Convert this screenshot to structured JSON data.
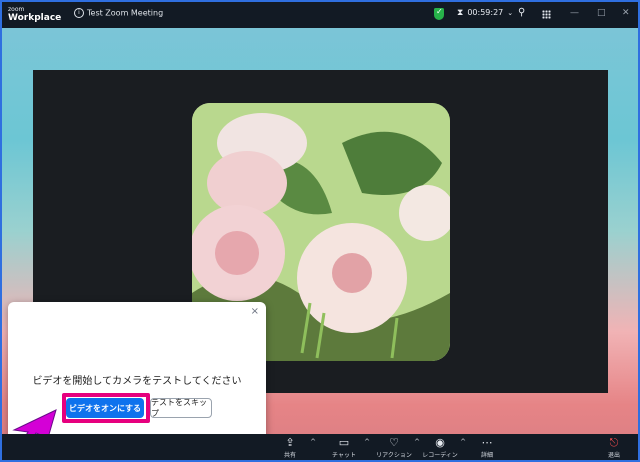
{
  "app": {
    "logo_small": "zoom",
    "logo_big": "Workplace",
    "meeting_title": "Test Zoom Meeting",
    "timer": "00:59:27"
  },
  "window": {
    "minimize": "—",
    "maximize": "□",
    "close": "✕"
  },
  "dialog": {
    "message": "ビデオを開始してカメラをテストしてください",
    "primary_button": "ビデオをオンにする",
    "secondary_button": "テストをスキップ",
    "close_label": "×"
  },
  "toolbar": {
    "items": [
      {
        "label": "共有",
        "icon": "share-icon"
      },
      {
        "label": "チャット",
        "icon": "chat-icon"
      },
      {
        "label": "リアクション",
        "icon": "reaction-icon"
      },
      {
        "label": "レコーディング",
        "icon": "record-icon"
      },
      {
        "label": "詳細",
        "icon": "more-icon"
      },
      {
        "label": "退出",
        "icon": "leave-icon"
      }
    ]
  },
  "colors": {
    "accent": "#0e72ed",
    "highlight": "#e6007e",
    "titlebar": "#121a24",
    "secure": "#27b24a"
  }
}
